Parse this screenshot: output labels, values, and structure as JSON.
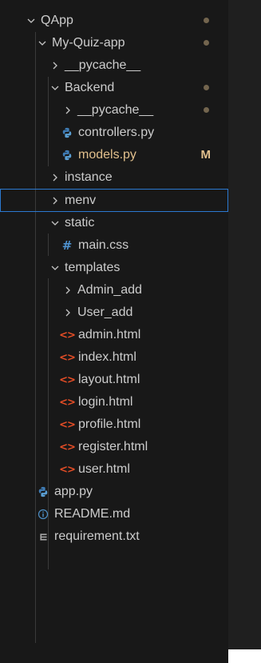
{
  "explorer": {
    "items": [
      {
        "label": "QApp",
        "icon": "chevron-down-icon",
        "indicator": "dot"
      },
      {
        "label": "My-Quiz-app",
        "icon": "chevron-down-icon",
        "indicator": "dot"
      },
      {
        "label": "__pycache__",
        "icon": "chevron-right-icon"
      },
      {
        "label": "Backend",
        "icon": "chevron-down-icon",
        "indicator": "dot"
      },
      {
        "label": "__pycache__",
        "icon": "chevron-right-icon",
        "indicator": "dot"
      },
      {
        "label": "controllers.py",
        "icon": "python-file-icon"
      },
      {
        "label": "models.py",
        "icon": "python-file-icon",
        "badge": "M"
      },
      {
        "label": "instance",
        "icon": "chevron-right-icon"
      },
      {
        "label": "menv",
        "icon": "chevron-right-icon",
        "selected": true
      },
      {
        "label": "static",
        "icon": "chevron-down-icon"
      },
      {
        "label": "main.css",
        "icon": "css-file-icon"
      },
      {
        "label": "templates",
        "icon": "chevron-down-icon"
      },
      {
        "label": "Admin_add",
        "icon": "chevron-right-icon"
      },
      {
        "label": "User_add",
        "icon": "chevron-right-icon"
      },
      {
        "label": "admin.html",
        "icon": "html-file-icon"
      },
      {
        "label": "index.html",
        "icon": "html-file-icon"
      },
      {
        "label": "layout.html",
        "icon": "html-file-icon"
      },
      {
        "label": "login.html",
        "icon": "html-file-icon"
      },
      {
        "label": "profile.html",
        "icon": "html-file-icon"
      },
      {
        "label": "register.html",
        "icon": "html-file-icon"
      },
      {
        "label": "user.html",
        "icon": "html-file-icon"
      },
      {
        "label": "app.py",
        "icon": "python-file-icon"
      },
      {
        "label": "README.md",
        "icon": "info-file-icon"
      },
      {
        "label": "requirement.txt",
        "icon": "text-file-icon"
      }
    ]
  },
  "colors": {
    "background": "#181818",
    "text": "#cccccc",
    "modified": "#e2c08d",
    "selection_border": "#2b79d0",
    "python_icon": "#4d8ec4",
    "html_icon": "#e44d26"
  }
}
